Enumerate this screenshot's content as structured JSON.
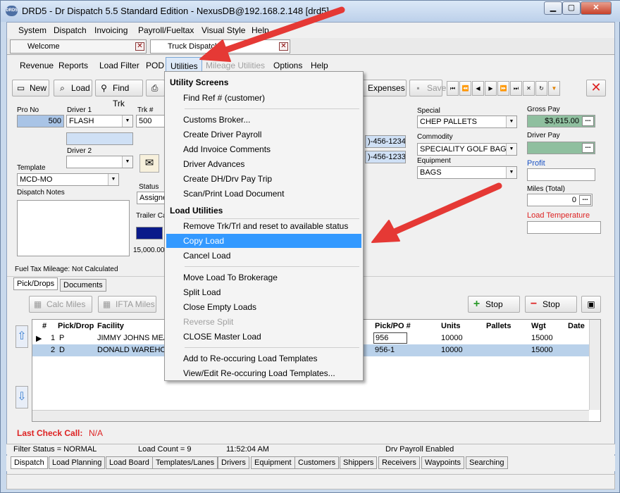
{
  "window": {
    "title": "DRD5 - Dr Dispatch 5.5 Standard Edition - NexusDB@192.168.2.148 [drd5]",
    "app_icon": "DRD5"
  },
  "menubar": [
    "System",
    "Dispatch",
    "Invoicing",
    "Payroll/Fueltax",
    "Visual Style",
    "Help"
  ],
  "doc_tabs": [
    "Welcome",
    "Truck Dispatch"
  ],
  "submenu": {
    "items": [
      "Revenue",
      "Reports",
      "Load Filter",
      "POD",
      "Utilities",
      "Mileage Utilities",
      "Options",
      "Help"
    ]
  },
  "toolbar": {
    "new": "New",
    "load": "Load",
    "find": "Find Trk",
    "p": "P",
    "expenses": "Expenses",
    "save": "Save"
  },
  "nav": [
    "⏮",
    "⏪",
    "◀",
    "▶",
    "⏩",
    "⏭",
    "✕",
    "↻",
    "▼"
  ],
  "form": {
    "pro_no_label": "Pro No",
    "pro_no": "500",
    "driver1_label": "Driver 1",
    "driver1": "FLASH",
    "trk_label": "Trk #",
    "trk": "500",
    "driver2_label": "Driver 2",
    "template_label": "Template",
    "template": "MCD-MO",
    "dispatch_notes_label": "Dispatch Notes",
    "status_label": "Status",
    "status": "Assigne",
    "trailer_label": "Trailer Ca",
    "weight_text": "15,000.00",
    "fuel_tax": "Fuel Tax Mileage:  Not Calculated",
    "phone1": ")-456-1234",
    "phone2": ")-456-1233",
    "special_label": "Special",
    "special": "CHEP PALLETS",
    "commodity_label": "Commodity",
    "commodity": "SPECIALITY GOLF BAGS",
    "equipment_label": "Equipment",
    "equipment": "BAGS",
    "gross_pay_label": "Gross Pay",
    "gross_pay": "$3,615.00",
    "driver_pay_label": "Driver Pay",
    "profit_label": "Profit",
    "miles_label": "Miles (Total)",
    "miles": "0",
    "load_temp_label": "Load Temperature"
  },
  "pick_tabs": [
    "Pick/Drops",
    "Documents"
  ],
  "pick_buttons": {
    "calc": "Calc Miles",
    "ifta": "IFTA Miles",
    "add_stop": "Stop",
    "remove_stop": "Stop"
  },
  "grid": {
    "headers": [
      "#",
      "Pick/Drop",
      "Facility",
      "Pick/PO #",
      "Units",
      "Pallets",
      "Wgt",
      "Date"
    ],
    "rows": [
      {
        "n": "1",
        "type": "P",
        "facility": "JIMMY JOHNS MEA",
        "po": "956",
        "units": "10000",
        "wgt": "15000"
      },
      {
        "n": "2",
        "type": "D",
        "facility": "DONALD WAREHO",
        "po": "956-1",
        "units": "10000",
        "wgt": "15000"
      }
    ]
  },
  "last_check": {
    "label": "Last Check Call:",
    "value": "N/A"
  },
  "statusbar": [
    "Filter Status = NORMAL",
    "Load Count = 9",
    "11:52:04 AM",
    "Drv Payroll Enabled"
  ],
  "bottom_tabs": [
    "Dispatch",
    "Load Planning",
    "Load Board",
    "Templates/Lanes",
    "Drivers",
    "Equipment",
    "Customers",
    "Shippers",
    "Receivers",
    "Waypoints",
    "Searching"
  ],
  "menu": {
    "header1": "Utility Screens",
    "group1": [
      "Find Ref # (customer)"
    ],
    "group2": [
      "Customs Broker...",
      "Create Driver Payroll",
      "Add Invoice Comments",
      "Driver Advances",
      "Create DH/Drv Pay Trip",
      "Scan/Print Load Document"
    ],
    "header2": "Load Utilities",
    "group3": [
      "Remove Trk/Trl and reset to available status",
      "Copy Load",
      "Cancel Load"
    ],
    "group4": [
      "Move Load To Brokerage",
      "Split Load",
      "Close Empty Loads",
      "Reverse Split",
      "CLOSE Master Load"
    ],
    "group5": [
      "Add to Re-occuring Load Templates",
      "View/Edit Re-occuring Load Templates..."
    ]
  },
  "colors": {
    "highlight": "#3399ff",
    "arrow": "#e53935",
    "pro_blue": "#a9c4e6",
    "gross_green": "#8fbf9f"
  }
}
